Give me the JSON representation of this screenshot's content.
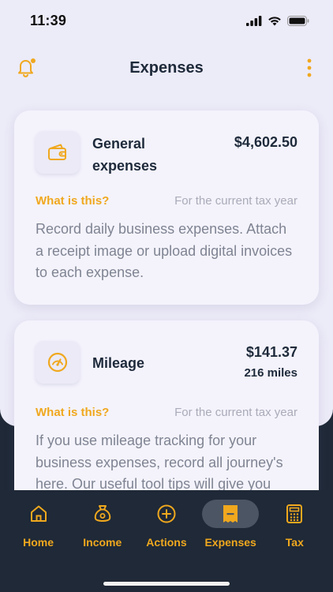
{
  "status": {
    "time": "11:39"
  },
  "header": {
    "title": "Expenses"
  },
  "cards": [
    {
      "title": "General expenses",
      "amount": "$4,602.50",
      "amount_sub": "",
      "what_label": "What is this?",
      "period": "For the current tax year",
      "description": "Record daily business expenses. Attach a receipt image or upload digital invoices to each expense.",
      "icon": "wallet-icon"
    },
    {
      "title": "Mileage",
      "amount": "$141.37",
      "amount_sub": "216 miles",
      "what_label": "What is this?",
      "period": "For the current tax year",
      "description": "If you use mileage tracking for your business expenses, record all journey's here. Our useful tool tips will give you",
      "icon": "speedometer-icon"
    }
  ],
  "tabs": [
    {
      "label": "Home",
      "icon": "home-icon",
      "active": false
    },
    {
      "label": "Income",
      "icon": "money-bag-icon",
      "active": false
    },
    {
      "label": "Actions",
      "icon": "plus-circle-icon",
      "active": false
    },
    {
      "label": "Expenses",
      "icon": "receipt-icon",
      "active": true
    },
    {
      "label": "Tax",
      "icon": "calculator-icon",
      "active": false
    }
  ],
  "colors": {
    "accent": "#f0a81e",
    "text_dark": "#1e2a3a",
    "background": "#ecebf8",
    "tabbar": "#1f2937"
  }
}
